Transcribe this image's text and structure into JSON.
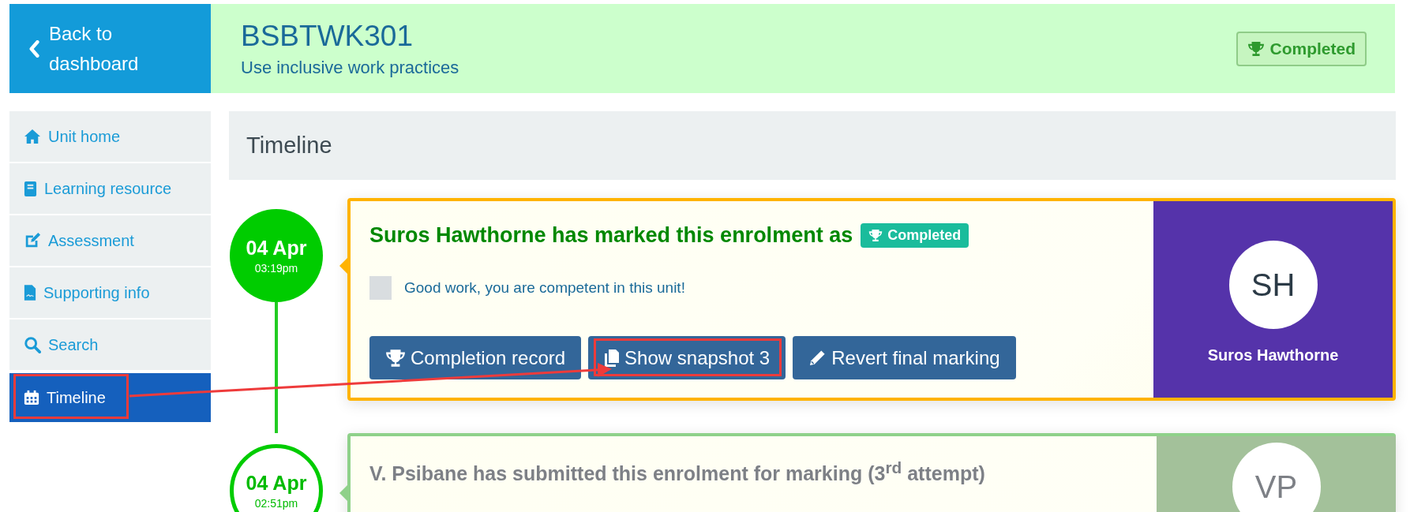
{
  "back_button": {
    "label": "Back to dashboard"
  },
  "unit": {
    "code": "BSBTWK301",
    "title": "Use inclusive work practices",
    "status": "Completed"
  },
  "sidebar": {
    "items": [
      {
        "label": "Unit home",
        "selected": false,
        "highlighted": false
      },
      {
        "label": "Learning resource",
        "selected": false,
        "highlighted": false
      },
      {
        "label": "Assessment",
        "selected": false,
        "highlighted": false
      },
      {
        "label": "Supporting info",
        "selected": false,
        "highlighted": false
      },
      {
        "label": "Search",
        "selected": false,
        "highlighted": false
      },
      {
        "label": "Timeline",
        "selected": true,
        "highlighted": true
      }
    ]
  },
  "page_title": "Timeline",
  "events": [
    {
      "kind": "marked",
      "date": "04 Apr",
      "time": "03:19pm",
      "title": "Suros Hawthorne has marked this enrolment as",
      "badge": "Completed",
      "comment": "Good work, you are competent in this unit!",
      "buttons": [
        {
          "label": "Completion record",
          "highlighted": false
        },
        {
          "label": "Show snapshot 3",
          "highlighted": true
        },
        {
          "label": "Revert final marking",
          "highlighted": false
        }
      ],
      "initials": "SH",
      "name": "Suros Hawthorne"
    },
    {
      "kind": "submitted",
      "date": "04 Apr",
      "time": "02:51pm",
      "title": "V. Psibane has submitted this enrolment for marking (3$^{rd}$ attempt)",
      "initials": "VP"
    }
  ]
}
